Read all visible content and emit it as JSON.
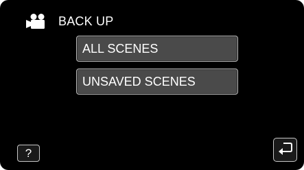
{
  "header": {
    "icon": "video-camera-icon",
    "title": "BACK UP"
  },
  "menu": {
    "items": [
      {
        "label": "ALL SCENES"
      },
      {
        "label": "UNSAVED SCENES"
      }
    ]
  },
  "footer": {
    "help_label": "?",
    "back_icon": "return-arrow-icon"
  },
  "colors": {
    "background": "#000000",
    "button_fill": "#4a4a4a",
    "button_border": "#b9b9b9",
    "text": "#ffffff"
  }
}
